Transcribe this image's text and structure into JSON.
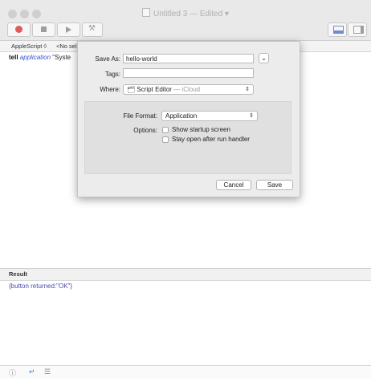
{
  "window": {
    "title": "Untitled 3",
    "edited": "— Edited ▾"
  },
  "editor": {
    "language": "AppleScript ◊",
    "element_selector": "<No sele",
    "code_keyword": "tell",
    "code_class": "application",
    "code_string": "\"Syste"
  },
  "save_sheet": {
    "save_as_label": "Save As:",
    "save_as_value": "hello-world",
    "tags_label": "Tags:",
    "tags_value": "",
    "where_label": "Where:",
    "where_value": "Script Editor",
    "where_location": "— iCloud",
    "file_format_label": "File Format:",
    "file_format_value": "Application",
    "options_label": "Options:",
    "options": [
      {
        "label": "Show startup screen",
        "checked": false
      },
      {
        "label": "Stay open after run handler",
        "checked": false
      }
    ],
    "cancel_label": "Cancel",
    "save_label": "Save"
  },
  "result": {
    "header": "Result",
    "text": "{button returned:\"OK\"}"
  },
  "icons": {
    "record": "record-icon",
    "stop": "stop-icon",
    "run": "run-icon",
    "compile": "hammer-icon",
    "show_log": "bottom-panel-icon",
    "show_inspector": "side-panel-icon",
    "info": "info-icon",
    "reply": "reply-icon",
    "log": "list-icon"
  }
}
